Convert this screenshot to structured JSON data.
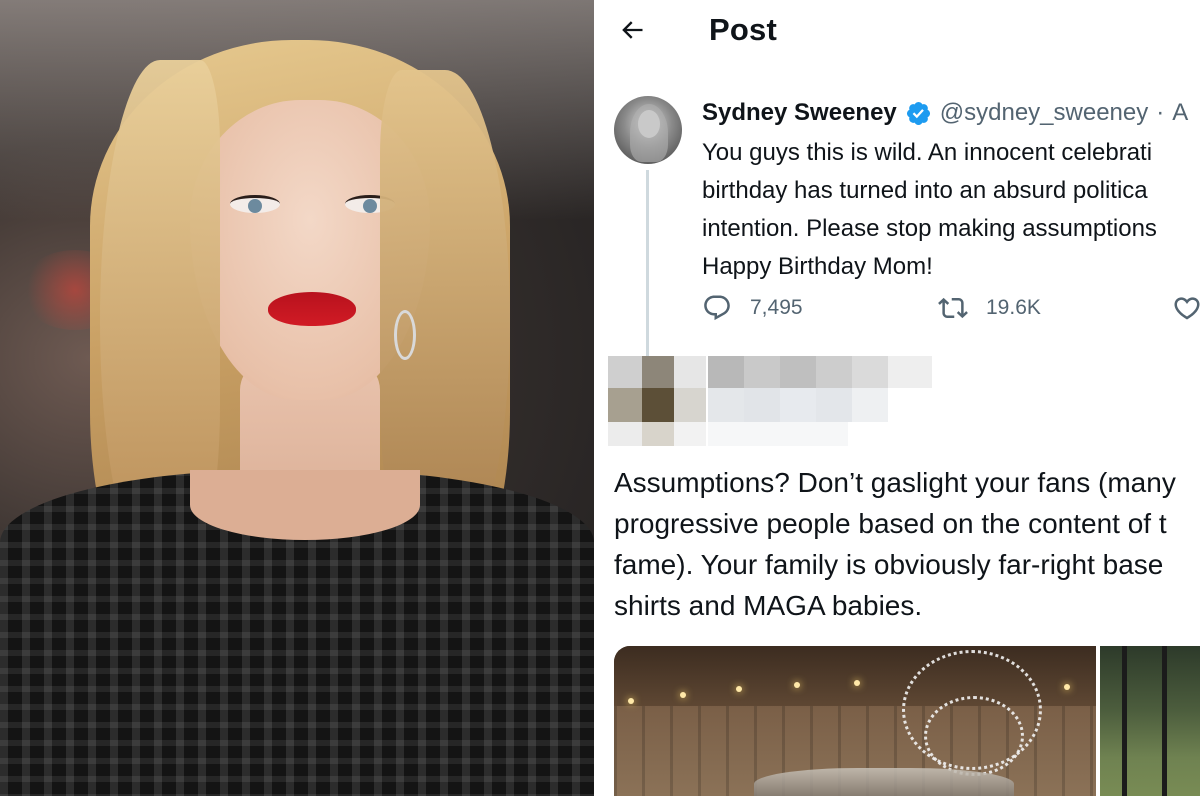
{
  "header": {
    "title": "Post"
  },
  "post": {
    "display_name": "Sydney Sweeney",
    "handle": "@sydney_sweeney",
    "separator": "·",
    "time": "A",
    "text_lines": [
      "You guys this is wild. An innocent celebrati",
      "birthday has turned into an absurd politica",
      "intention. Please stop making assumptions",
      "Happy Birthday Mom!"
    ],
    "stats": {
      "replies": "7,495",
      "reposts": "19.6K"
    }
  },
  "reply": {
    "text_lines": [
      "Assumptions? Don’t gaslight your fans (many",
      "progressive people based on the content of t",
      "fame). Your family is obviously far-right base",
      "shirts and MAGA babies."
    ]
  },
  "colors": {
    "verified": "#1d9bf0",
    "text": "#0f1419",
    "secondary": "#536471",
    "thread_line": "#cfd9de"
  },
  "icons": [
    "back-arrow-icon",
    "verified-badge-icon",
    "reply-icon",
    "repost-icon",
    "like-icon"
  ]
}
